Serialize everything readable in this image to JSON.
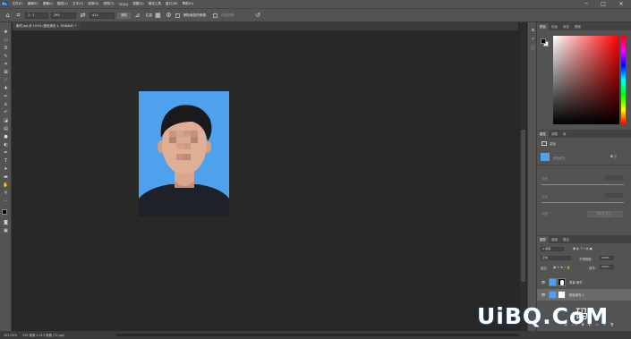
{
  "menubar": {
    "logo": "Ps",
    "items": [
      "文件(F)",
      "编辑(E)",
      "图像(I)",
      "图层(L)",
      "文字(Y)",
      "选择(S)",
      "滤镜(T)",
      "3D(D)",
      "视图(V)",
      "增效工具",
      "窗口(W)",
      "帮助(H)"
    ]
  },
  "window": {
    "minimize": "─",
    "maximize": "□",
    "close": "✕"
  },
  "options": {
    "tool_icon": "crop-tool-icon",
    "ratio": "1 : 1",
    "width": "295",
    "height": "413",
    "clear_label": "清除",
    "straighten_label": "拉直",
    "delete_pixels_label": "删除裁剪的像素",
    "content_aware_label": "内容识别"
  },
  "document": {
    "tab_title": "素材.jpg @ 101% (颜色填充 1, RGB/8#) *"
  },
  "status": {
    "zoom": "101.05%",
    "doc_info": "295 像素 x 413 像素 (72 ppi)"
  },
  "color_panel": {
    "tabs": [
      "颜色",
      "色板",
      "渐变",
      "图案"
    ]
  },
  "properties_panel": {
    "tabs": [
      "属性",
      "调整",
      "库"
    ],
    "kind_label": "蒙版",
    "layer_label": "颜色填充",
    "density_label": "浓度",
    "feather_label": "羽化",
    "refine_label": "调整",
    "select_mask_label": "选择并遮住..."
  },
  "layers_panel": {
    "tabs": [
      "图层",
      "通道",
      "路径"
    ],
    "kind_filter": "Q 类型",
    "blend_mode": "正常",
    "opacity_label": "不透明度:",
    "opacity_value": "100%",
    "lock_label": "锁定:",
    "fill_label": "填充:",
    "fill_value": "100%",
    "layers": [
      {
        "name": "背景 拷贝"
      },
      {
        "name": "颜色填充 1"
      }
    ]
  },
  "watermark": {
    "text": "UiBQ.CoM",
    "sub": "码"
  },
  "colors": {
    "photo_background": "#4ea1ec",
    "foreground": "#000000",
    "background": "#ffffff"
  }
}
